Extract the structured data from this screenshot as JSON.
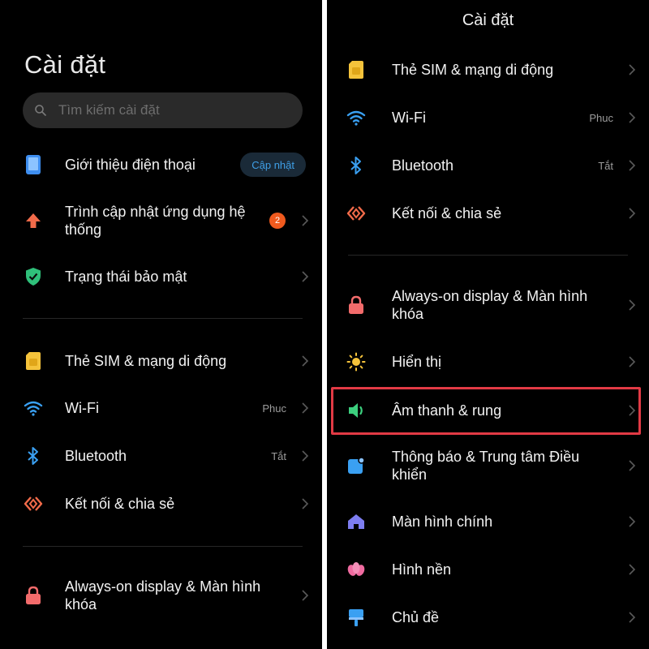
{
  "left": {
    "title": "Cài đặt",
    "search": {
      "placeholder": "Tìm kiếm cài đặt"
    },
    "items": [
      {
        "label": "Giới thiệu điện thoại",
        "action": "Cập nhật",
        "icon": "phone-icon"
      },
      {
        "label": "Trình cập nhật ứng dụng hệ thống",
        "badge": "2",
        "icon": "arrow-up-icon"
      },
      {
        "label": "Trạng thái bảo mật",
        "icon": "shield-check-icon"
      },
      {
        "label": "Thẻ SIM & mạng di động",
        "icon": "sim-card-icon"
      },
      {
        "label": "Wi-Fi",
        "value": "Phuc",
        "icon": "wifi-icon"
      },
      {
        "label": "Bluetooth",
        "value": "Tắt",
        "icon": "bluetooth-icon"
      },
      {
        "label": "Kết nối & chia sẻ",
        "icon": "share-icon"
      },
      {
        "label": "Always-on display & Màn hình khóa",
        "icon": "lock-icon"
      }
    ]
  },
  "right": {
    "title": "Cài đặt",
    "items": [
      {
        "label": "Thẻ SIM & mạng di động",
        "icon": "sim-card-icon"
      },
      {
        "label": "Wi-Fi",
        "value": "Phuc",
        "icon": "wifi-icon"
      },
      {
        "label": "Bluetooth",
        "value": "Tắt",
        "icon": "bluetooth-icon"
      },
      {
        "label": "Kết nối & chia sẻ",
        "icon": "share-icon"
      },
      {
        "label": "Always-on display & Màn hình khóa",
        "icon": "lock-icon"
      },
      {
        "label": "Hiển thị",
        "icon": "sun-icon"
      },
      {
        "label": "Âm thanh & rung",
        "icon": "speaker-icon",
        "highlighted": true
      },
      {
        "label": "Thông báo & Trung tâm Điều khiển",
        "icon": "notification-icon"
      },
      {
        "label": "Màn hình chính",
        "icon": "home-icon"
      },
      {
        "label": "Hình nền",
        "icon": "flower-icon"
      },
      {
        "label": "Chủ đề",
        "icon": "theme-brush-icon"
      }
    ]
  },
  "colors": {
    "background": "#000000",
    "accent_blue": "#3f9fe6",
    "badge_orange": "#f05a1e",
    "highlight_red": "#e23a45"
  }
}
